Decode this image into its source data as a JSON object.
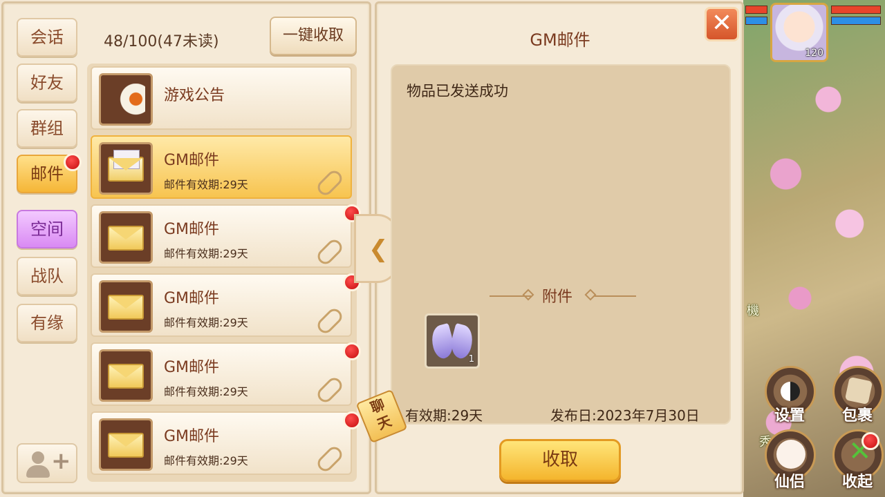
{
  "tabs": [
    {
      "label": "会话"
    },
    {
      "label": "好友"
    },
    {
      "label": "群组"
    },
    {
      "label": "邮件"
    },
    {
      "label": "空间"
    },
    {
      "label": "战队"
    },
    {
      "label": "有缘"
    }
  ],
  "mail_count": "48/100(47未读)",
  "claim_all_label": "一键收取",
  "announcement": {
    "title": "游戏公告"
  },
  "mails": [
    {
      "title": "GM邮件",
      "subtitle": "邮件有效期:29天"
    },
    {
      "title": "GM邮件",
      "subtitle": "邮件有效期:29天"
    },
    {
      "title": "GM邮件",
      "subtitle": "邮件有效期:29天"
    },
    {
      "title": "GM邮件",
      "subtitle": "邮件有效期:29天"
    },
    {
      "title": "GM邮件",
      "subtitle": "邮件有效期:29天"
    }
  ],
  "chat_tag": [
    "聊",
    "天"
  ],
  "detail": {
    "title": "GM邮件",
    "body": "物品已发送成功",
    "attachment_label": "附件",
    "item_qty": "1",
    "validity": "有效期:29天",
    "publish_date": "发布日:2023年7月30日",
    "claim_label": "收取",
    "close_glyph": "✕"
  },
  "scene": {
    "player_level": "120",
    "buttons": [
      {
        "label": "设置",
        "icon": "yin-yang-icon"
      },
      {
        "label": "包裹",
        "icon": "bag-icon"
      },
      {
        "label": "仙侣",
        "icon": "companion-icon"
      },
      {
        "label": "收起",
        "icon": "collapse-x-icon"
      }
    ],
    "fragments": [
      "機",
      "秀"
    ]
  },
  "colors": {
    "accent_gold": "#f4b52d",
    "unread_red": "#d71616",
    "panel_bg": "#f5ead7"
  }
}
